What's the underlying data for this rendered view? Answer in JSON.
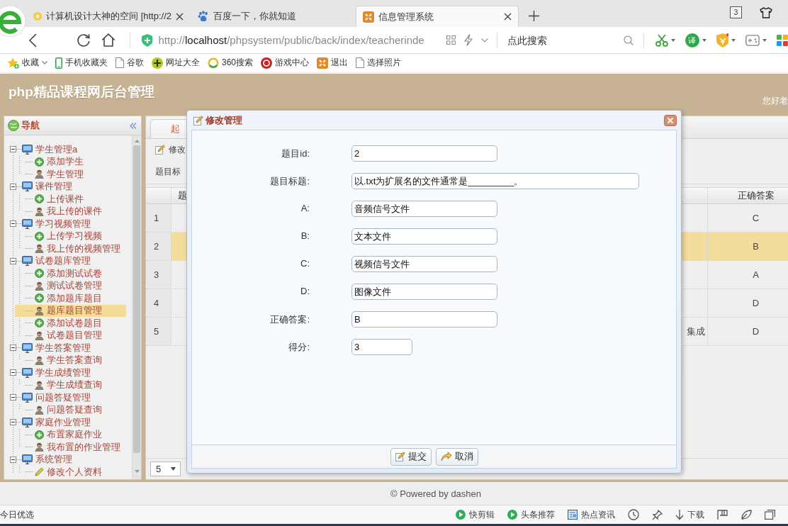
{
  "browser": {
    "tabs": [
      {
        "label": "计算机设计大神的空间 [http://2",
        "kind": "star",
        "selected": false,
        "closable": true
      },
      {
        "label": "百度一下，你就知道",
        "kind": "paw",
        "selected": false,
        "closable": false
      },
      {
        "label": "信息管理系统",
        "kind": "app",
        "selected": true,
        "closable": true
      }
    ],
    "tab_count": "3",
    "address": {
      "scheme": "http://",
      "host": "localhost",
      "path": "/phpsystem/public/back/index/teacherinde"
    },
    "search": {
      "placeholder": "点此搜索"
    },
    "translate_label": "译",
    "bookmarks": [
      {
        "label": "收藏",
        "kind": "star"
      },
      {
        "label": "手机收藏夹",
        "kind": "phone"
      },
      {
        "label": "谷歌",
        "kind": "doc"
      },
      {
        "label": "网址大全",
        "kind": "globe"
      },
      {
        "label": "360搜索",
        "kind": "ring"
      },
      {
        "label": "游戏中心",
        "kind": "game"
      },
      {
        "label": "退出",
        "kind": "app"
      },
      {
        "label": "选择照片",
        "kind": "doc"
      }
    ]
  },
  "site": {
    "title": "php精品课程网后台管理",
    "greeting": "您好老"
  },
  "nav": {
    "title": "导航",
    "groups": [
      {
        "label": "学生管理a",
        "expanded": true,
        "children": [
          {
            "label": "添加学生",
            "kind": "add",
            "selected": false
          },
          {
            "label": "学生管理",
            "kind": "user",
            "selected": false
          }
        ]
      },
      {
        "label": "课件管理",
        "expanded": true,
        "children": [
          {
            "label": "上传课件",
            "kind": "add",
            "selected": false
          },
          {
            "label": "我上传的课件",
            "kind": "user",
            "selected": false
          }
        ]
      },
      {
        "label": "学习视频管理",
        "expanded": true,
        "children": [
          {
            "label": "上传学习视频",
            "kind": "add",
            "selected": false
          },
          {
            "label": "我上传的视频管理",
            "kind": "user",
            "selected": false
          }
        ]
      },
      {
        "label": "试卷题库管理",
        "expanded": true,
        "children": [
          {
            "label": "添加测试试卷",
            "kind": "add",
            "selected": false
          },
          {
            "label": "测试试卷管理",
            "kind": "user",
            "selected": false
          },
          {
            "label": "添加题库题目",
            "kind": "add",
            "selected": false
          },
          {
            "label": "题库题目管理",
            "kind": "user",
            "selected": true
          },
          {
            "label": "添加试卷题目",
            "kind": "add",
            "selected": false
          },
          {
            "label": "试卷题目管理",
            "kind": "user",
            "selected": false
          }
        ]
      },
      {
        "label": "学生答案管理",
        "expanded": true,
        "children": [
          {
            "label": "学生答案查询",
            "kind": "user",
            "selected": false
          }
        ]
      },
      {
        "label": "学生成绩管理",
        "expanded": true,
        "children": [
          {
            "label": "学生成绩查询",
            "kind": "user",
            "selected": false
          }
        ]
      },
      {
        "label": "问题答疑管理",
        "expanded": true,
        "children": [
          {
            "label": "问题答疑查询",
            "kind": "user",
            "selected": false
          }
        ]
      },
      {
        "label": "家庭作业管理",
        "expanded": true,
        "children": [
          {
            "label": "布置家庭作业",
            "kind": "add",
            "selected": false
          },
          {
            "label": "我布置的作业管理",
            "kind": "user",
            "selected": false
          }
        ]
      },
      {
        "label": "系统管理",
        "expanded": true,
        "children": [
          {
            "label": "修改个人资料",
            "kind": "edit",
            "selected": false
          }
        ]
      }
    ]
  },
  "grid": {
    "tab": "起",
    "toolbar": [
      {
        "label": "修改",
        "kind": "edit"
      }
    ],
    "search_label": "题目标",
    "columns": [
      {
        "label": "题"
      },
      {
        "label": "正确答案"
      }
    ],
    "rows": [
      {
        "number": "1",
        "correct_answer": "C",
        "selected": false
      },
      {
        "number": "2",
        "correct_answer": "B",
        "selected": true
      },
      {
        "number": "3",
        "correct_answer": "A",
        "selected": false
      },
      {
        "number": "4",
        "correct_answer": "D",
        "selected": false
      },
      {
        "number": "5",
        "column_1": "集成",
        "correct_answer": "D",
        "selected": false
      }
    ],
    "page_size": "5"
  },
  "dialog": {
    "title": "修改管理",
    "fields": [
      {
        "label": "题目id:",
        "value": "2",
        "kind": "text"
      },
      {
        "label": "题目标题:",
        "value": "以.txt为扩展名的文件通常是_________。",
        "kind": "wide"
      },
      {
        "label": "A:",
        "value": "音频信号文件",
        "kind": "text"
      },
      {
        "label": "B:",
        "value": "文本文件",
        "kind": "text"
      },
      {
        "label": "C:",
        "value": "视频信号文件",
        "kind": "text"
      },
      {
        "label": "D:",
        "value": "图像文件",
        "kind": "text"
      },
      {
        "label": "正确答案:",
        "value": "B",
        "kind": "text"
      },
      {
        "label": "得分:",
        "value": "3",
        "kind": "small"
      }
    ],
    "buttons": [
      {
        "label": "提交",
        "kind": "submit"
      },
      {
        "label": "取消",
        "kind": "cancel"
      }
    ]
  },
  "footer": "© Powered by dashen",
  "status_bar": {
    "left": "今日优选",
    "items": [
      {
        "label": "快剪辑",
        "kind": "play"
      },
      {
        "label": "头条推荐",
        "kind": "play"
      },
      {
        "label": "热点资讯",
        "kind": "news"
      },
      {
        "kind": "clock"
      },
      {
        "kind": "pin"
      },
      {
        "label": "下载",
        "kind": "download"
      },
      {
        "kind": "flag"
      },
      {
        "kind": "leaf"
      },
      {
        "kind": "window"
      }
    ]
  }
}
